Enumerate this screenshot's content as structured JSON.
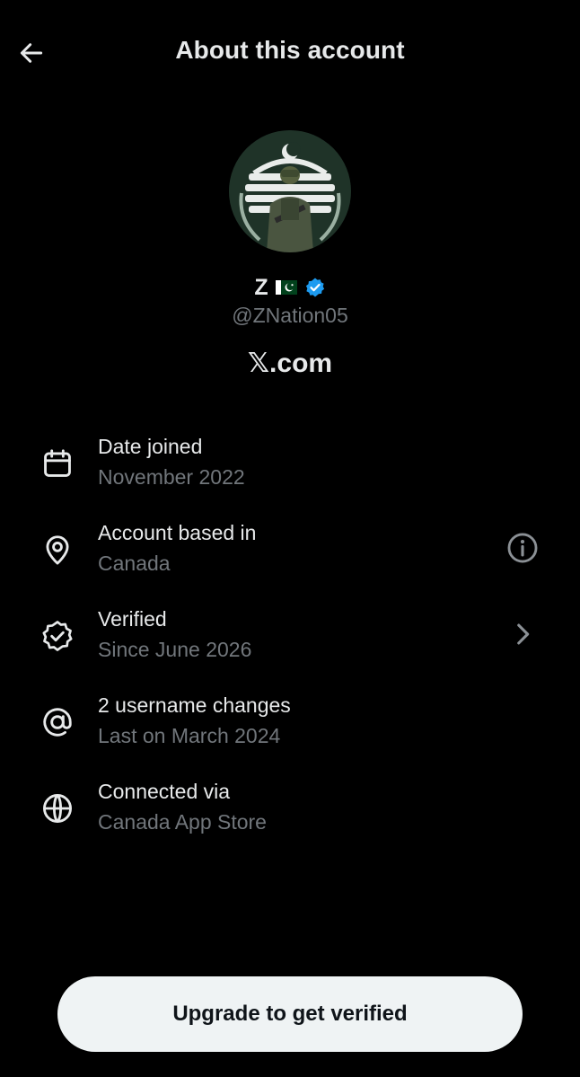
{
  "header": {
    "title": "About this account",
    "back_icon": "arrow-left-icon"
  },
  "profile": {
    "display_name": "Z",
    "flag_icon": "pakistan-flag-icon",
    "verified_icon": "verified-badge-icon",
    "handle": "@ZNation05",
    "site": "𝕏.com"
  },
  "details": [
    {
      "icon": "calendar-icon",
      "label": "Date joined",
      "value": "November 2022"
    },
    {
      "icon": "location-pin-icon",
      "label": "Account based in",
      "value": "Canada",
      "trailing_icon": "info-icon"
    },
    {
      "icon": "verified-outline-icon",
      "label": "Verified",
      "value": "Since June 2026",
      "trailing_icon": "chevron-right-icon"
    },
    {
      "icon": "at-sign-icon",
      "label": "2 username changes",
      "value": "Last on March 2024"
    },
    {
      "icon": "globe-icon",
      "label": "Connected via",
      "value": "Canada App Store"
    }
  ],
  "cta": {
    "label": "Upgrade to get verified"
  },
  "colors": {
    "background": "#000000",
    "primary_text": "#e7e9ea",
    "secondary_text": "#71767b",
    "verified_blue": "#1d9bf0",
    "button_bg": "#eff3f4",
    "button_text": "#0f1419"
  }
}
